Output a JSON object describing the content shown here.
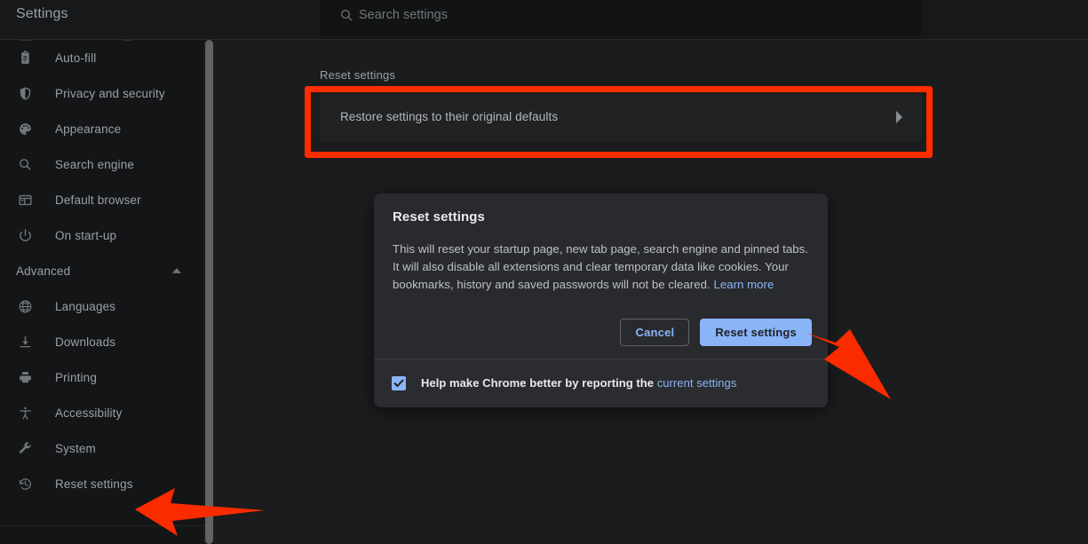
{
  "header": {
    "title": "Settings",
    "search": {
      "placeholder": "Search settings",
      "value": "",
      "icon": "search-icon"
    }
  },
  "sidebar": {
    "items": [
      {
        "label": "Auto-fill",
        "icon": "clipboard-icon"
      },
      {
        "label": "Privacy and security",
        "icon": "shield-icon"
      },
      {
        "label": "Appearance",
        "icon": "palette-icon"
      },
      {
        "label": "Search engine",
        "icon": "magnifier-icon"
      },
      {
        "label": "Default browser",
        "icon": "browser-window-icon"
      },
      {
        "label": "On start-up",
        "icon": "power-icon"
      }
    ],
    "section": {
      "label": "Advanced",
      "chevron": "chevron-up-icon",
      "items": [
        {
          "label": "Languages",
          "icon": "globe-icon"
        },
        {
          "label": "Downloads",
          "icon": "download-icon"
        },
        {
          "label": "Printing",
          "icon": "printer-icon"
        },
        {
          "label": "Accessibility",
          "icon": "accessibility-icon"
        },
        {
          "label": "System",
          "icon": "wrench-icon"
        },
        {
          "label": "Reset settings",
          "icon": "history-restore-icon"
        }
      ]
    }
  },
  "main": {
    "section_title": "Reset settings",
    "restore_card": {
      "label": "Restore settings to their original defaults",
      "chevron": "chevron-right-icon"
    }
  },
  "dialog": {
    "title": "Reset settings",
    "body_text_1": "This will reset your startup page, new tab page, search engine and pinned tabs. It will also disable all extensions and clear temporary data like cookies. Your bookmarks, history and saved passwords will not be cleared. ",
    "learn_more_link": "Learn more",
    "cancel_button": "Cancel",
    "confirm_button": "Reset settings",
    "footer": {
      "checkbox_checked": true,
      "label_text": "Help make Chrome better by reporting the ",
      "link_text": "current settings"
    }
  },
  "annotations": {
    "highlight_color": "#ff2d00",
    "arrow_color": "#fb2b00",
    "highlight_target": "restore-settings-row",
    "arrow_dialog_target": "dialog-confirm-button",
    "arrow_sidebar_target": "sidebar-item-reset-settings"
  },
  "colors": {
    "page_background": "#1b1c1d",
    "sidebar_background": "#141516",
    "header_background": "#17181a",
    "dialog_background": "#292a2d",
    "accent_blue": "#8ab4f8",
    "text_primary": "#e8eaed",
    "text_secondary": "#9aa0a6"
  }
}
